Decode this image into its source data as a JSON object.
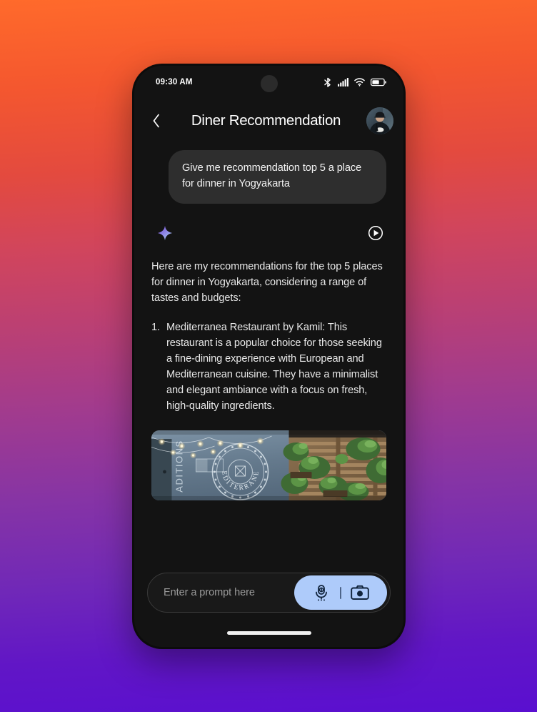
{
  "background": {
    "gradient_top": "#ff6a2b",
    "gradient_mid": "#bc4072",
    "gradient_bottom": "#5a0fd0"
  },
  "status_bar": {
    "time": "09:30 AM",
    "icons": [
      "bluetooth-icon",
      "cellular-signal-icon",
      "wifi-icon",
      "battery-icon"
    ],
    "battery_level_percent": 55
  },
  "app_bar": {
    "back_label": "‹",
    "title": "Diner Recommendation",
    "avatar_name": "user-avatar"
  },
  "conversation": {
    "user_message": "Give me recommendation top 5 a place for dinner in Yogyakarta",
    "assistant": {
      "brand_icon": "sparkle-icon",
      "brand_icon_colors": {
        "start": "#8e6ce0",
        "end": "#9fc6f0"
      },
      "play_icon": "play-circle-icon",
      "intro": "Here are my recommendations for the top 5 places for dinner in Yogyakarta, considering a range of tastes and budgets:",
      "items": [
        {
          "number": "1.",
          "text": "Mediterranea Restaurant by Kamil: This restaurant is a popular choice for those seeking a fine-dining experience with European and Mediterranean cuisine. They have a minimalist and elegant ambiance with a focus on fresh, high-quality ingredients."
        }
      ],
      "photo": {
        "name": "restaurant-photo",
        "alt_text": "Mediterranea Restaurant exterior with string lights, circular MEDITERRANEA logo on blue wall, and wooden slat wall with plants",
        "logo_text": "MEDITERRANEA",
        "wall_text": "ADITIONS"
      }
    }
  },
  "input_bar": {
    "placeholder": "Enter a prompt here",
    "value": "",
    "pill_color": "#aecbfa",
    "mic_icon": "microphone-icon",
    "camera_icon": "camera-icon"
  },
  "nav": {
    "home_indicator": "home-indicator"
  }
}
